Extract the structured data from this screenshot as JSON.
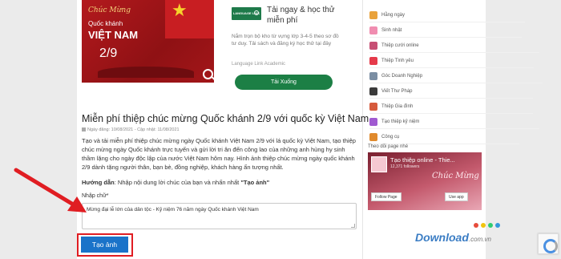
{
  "card": {
    "line1": "Chúc Mừng",
    "line2": "Quốc khánh",
    "line3": "VIỆT NAM",
    "line4": "2/9",
    "star_icon": "star-icon",
    "zoom_icon": "zoom-icon"
  },
  "ad": {
    "logo": "LANGUAGE LINK",
    "title": "Tải ngay & học thử miễn phí",
    "description": "Nắm trọn bộ kho từ vựng lớp 3-4-5 theo sơ đồ tư duy. Tải sách và đăng ký học thử tại đây",
    "source": "Language Link Academic",
    "button": "Tải Xuống",
    "brand_color": "#1c7f45"
  },
  "article": {
    "title": "Miễn phí thiệp chúc mừng Quốc khánh 2/9 với quốc kỳ Việt Nam",
    "meta": "Ngày đăng: 10/08/2021 - Cập nhật: 11/08/2021",
    "body": "Tạo và tải miễn phí thiệp chúc mừng ngày Quốc khánh Việt Nam 2/9 với lá quốc kỳ Việt Nam, tạo thiệp chúc mừng ngày Quốc khánh trực tuyến và gửi lời tri ân đến công lao của những anh hùng hy sinh thầm lặng cho ngày độc lập của nước Việt Nam hôm nay. Hình ảnh thiệp chúc mừng ngày quốc khánh 2/9 dành tặng người thân, bạn bè, đồng nghiệp, khách hàng ấn tượng nhất.",
    "guide_label": "Hướng dẫn",
    "guide_text": ": Nhập nội dung lời chúc của bạn và nhấn nhất",
    "guide_quote": "\"Tạo ảnh\"",
    "input_label": "Nhập chữ*",
    "input_value": "Mừng đại lễ lớn của dân tộc - Kỷ niệm 76 năm ngày Quốc khánh Việt Nam",
    "create_button": "Tạo ảnh",
    "button_color": "#1a73c9",
    "highlight_color": "#e01d22"
  },
  "sidebar": {
    "items": [
      {
        "label": "Hằng ngày",
        "color": "#e9a23b",
        "icon": "calendar-icon"
      },
      {
        "label": "Sinh nhật",
        "color": "#f08db0",
        "icon": "cake-icon"
      },
      {
        "label": "Thiệp cưới online",
        "color": "#c74f74",
        "icon": "rings-icon"
      },
      {
        "label": "Thiệp Tình yêu",
        "color": "#e53a4a",
        "icon": "heart-icon"
      },
      {
        "label": "Góc Doanh Nghiệp",
        "color": "#7b8ea3",
        "icon": "briefcase-icon"
      },
      {
        "label": "Viết Thư Pháp",
        "color": "#3a3a3a",
        "icon": "brush-icon"
      },
      {
        "label": "Thiệp Gia đình",
        "color": "#d65a3c",
        "icon": "family-icon"
      },
      {
        "label": "Tạo thiệp kỷ niệm",
        "color": "#a05ad1",
        "icon": "anniversary-icon"
      },
      {
        "label": "Công cụ",
        "color": "#e08a2d",
        "icon": "tools-icon"
      }
    ],
    "fanpage_label": "Theo dõi page nhé",
    "fanpage_title": "Tạo thiệp online - Thie...",
    "fanpage_followers": "12,371 followers",
    "fanpage_script": "Chúc Mừng",
    "follow_button": "Follow Page",
    "use_button": "Use app"
  },
  "watermark": {
    "brand": "Download",
    "domain": ".com.vn",
    "dot_colors": [
      "#e74c3c",
      "#f1c40f",
      "#2ecc71",
      "#3498db"
    ]
  }
}
